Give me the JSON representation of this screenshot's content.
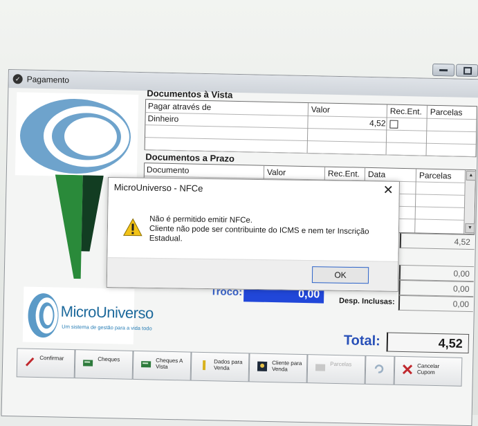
{
  "window": {
    "title": "Pagamento"
  },
  "docs_vista": {
    "title": "Documentos à Vista",
    "headers": [
      "Pagar através de",
      "Valor",
      "Rec.Ent.",
      "Parcelas"
    ],
    "rows": [
      {
        "method": "Dinheiro",
        "value": "4,52"
      }
    ]
  },
  "docs_prazo": {
    "title": "Documentos a Prazo",
    "headers": [
      "Documento",
      "Valor",
      "Rec.Ent.",
      "Data",
      "Parcelas"
    ]
  },
  "totals": {
    "values": [
      "4,52",
      "0,00",
      "0,00",
      "0,00"
    ],
    "desp_label": "Desp. Inclusas:",
    "troco_label": "Troco:",
    "troco_value": "0,00",
    "total_label": "Total:",
    "total_value": "4,52"
  },
  "logo": {
    "name": "MicroUniverso",
    "slogan": "Um sistema de gestão para a vida todo"
  },
  "toolbar": {
    "buttons": [
      {
        "label": "Confirmar",
        "icon": "pencil-icon"
      },
      {
        "label": "Cheques",
        "icon": "cheques-icon"
      },
      {
        "label": "Cheques A Vista",
        "icon": "cheques-vista-icon"
      },
      {
        "label": "Dados para Venda",
        "icon": "pen-icon"
      },
      {
        "label": "Cliente para Venda",
        "icon": "client-icon"
      },
      {
        "label": "Parcelas",
        "icon": "parcelas-icon"
      },
      {
        "label": "",
        "icon": "undo-icon"
      },
      {
        "label": "Cancelar Cupom",
        "icon": "cancel-x-icon"
      }
    ]
  },
  "dialog": {
    "title": "MicroUniverso - NFCe",
    "message": "Não é permitido emitir NFCe.\nCliente não pode ser contribuinte do ICMS e nem ter Inscrição Estadual.",
    "ok_label": "OK"
  },
  "colors": {
    "accent_blue": "#2147d9",
    "logo_blue": "#5b9ac7",
    "green": "#2a8a3a"
  }
}
